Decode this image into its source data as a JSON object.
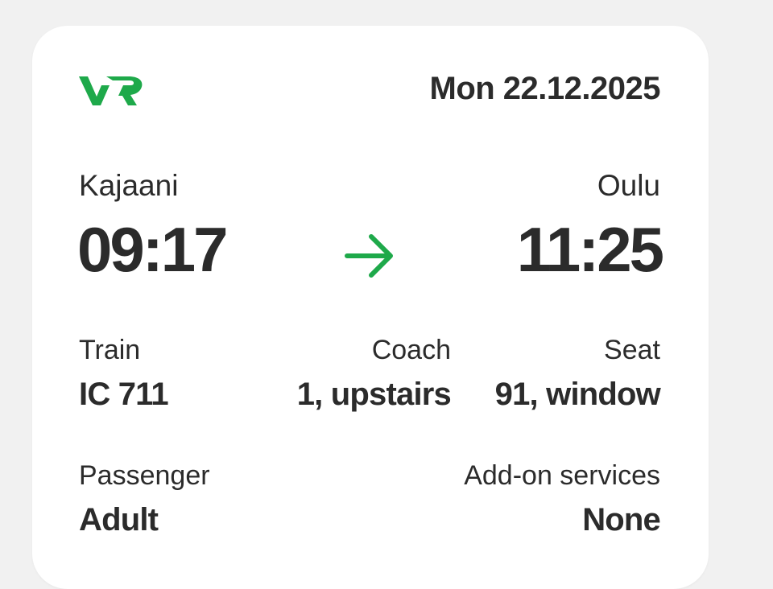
{
  "ticket": {
    "brand": "VR",
    "brand_color": "#1ea94a",
    "date": "Mon 22.12.2025",
    "from_station": "Kajaani",
    "departure_time": "09:17",
    "to_station": "Oulu",
    "arrival_time": "11:25",
    "arrow_icon": "arrow-right-icon",
    "train_label": "Train",
    "train_value": "IC 711",
    "coach_label": "Coach",
    "coach_value": "1, upstairs",
    "seat_label": "Seat",
    "seat_value": "91, window",
    "passenger_label": "Passenger",
    "passenger_value": "Adult",
    "addons_label": "Add-on services",
    "addons_value": "None"
  }
}
